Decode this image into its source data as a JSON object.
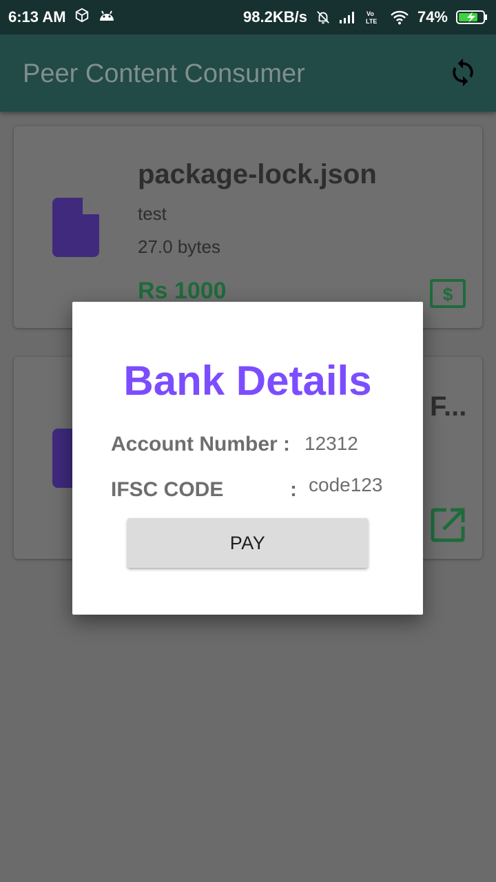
{
  "status_bar": {
    "time": "6:13 AM",
    "net_speed": "98.2KB/s",
    "battery": "74%",
    "icons": [
      "cube-icon",
      "android-icon",
      "alarm-off-icon",
      "signal-icon",
      "volte-icon",
      "wifi-icon",
      "battery-charging-icon"
    ]
  },
  "app_bar": {
    "title": "Peer Content Consumer",
    "action_icon": "sync-icon"
  },
  "cards": [
    {
      "name": "package-lock.json",
      "description": "test",
      "size": "27.0 bytes",
      "price": "Rs 1000",
      "icon": "file-icon",
      "action_icon": "buy-icon"
    },
    {
      "name": "F...",
      "icon": "file-icon",
      "action_icon": "open-external-icon"
    }
  ],
  "dialog": {
    "title": "Bank Details",
    "account_label": "Account Number :",
    "account_value": "12312",
    "ifsc_label": "IFSC CODE",
    "ifsc_colon": ":",
    "ifsc_value": "code123",
    "pay_label": "PAY"
  },
  "colors": {
    "status_bar": "#16312f",
    "app_bar": "#224a47",
    "accent": "#7c4dff",
    "file_icon": "#3f2a7e",
    "price": "#1f6b3c",
    "scrim_bg": "#6b6b6b"
  }
}
